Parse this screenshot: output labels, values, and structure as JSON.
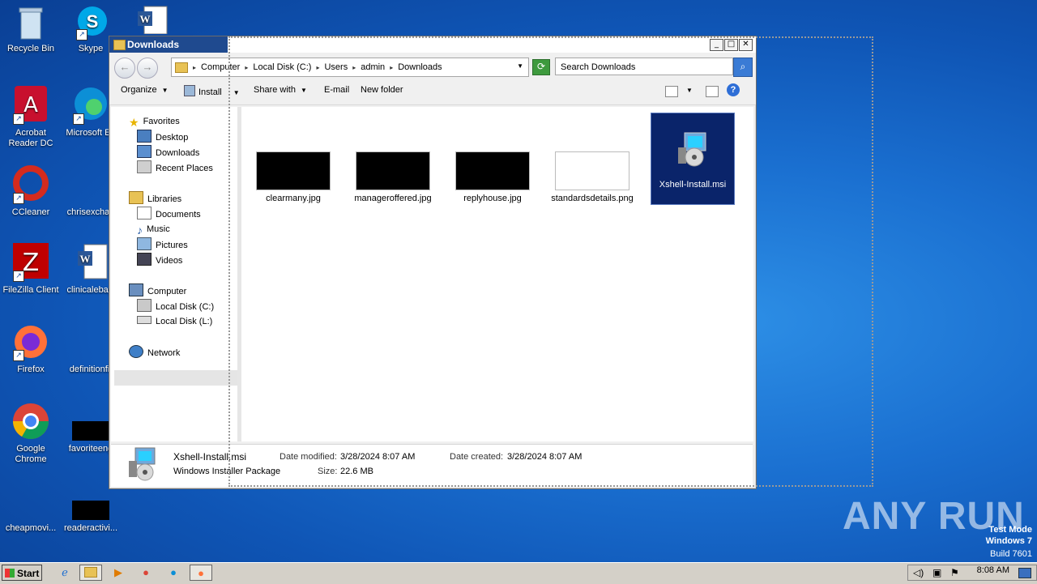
{
  "desktop": {
    "icons": [
      {
        "label": "Recycle Bin"
      },
      {
        "label": "Skype"
      },
      {
        "label": "Acrobat Reader DC"
      },
      {
        "label": "Microsoft Ed"
      },
      {
        "label": "CCleaner"
      },
      {
        "label": "chrisexchan"
      },
      {
        "label": "FileZilla Client"
      },
      {
        "label": "clinicalebay."
      },
      {
        "label": "Firefox"
      },
      {
        "label": "definitionfi."
      },
      {
        "label": "Google Chrome"
      },
      {
        "label": "favoriteeng"
      },
      {
        "label": "cheapmovi..."
      },
      {
        "label": "readeractivi..."
      }
    ]
  },
  "window": {
    "title": "Downloads",
    "controls": {
      "min": "_",
      "max": "□",
      "close": "✕"
    },
    "address": {
      "crumbs": [
        "Computer",
        "Local Disk (C:)",
        "Users",
        "admin",
        "Downloads"
      ]
    },
    "search": {
      "placeholder": "Search Downloads"
    },
    "toolbar": {
      "organize": "Organize",
      "install": "Install",
      "share_with": "Share with",
      "email": "E-mail",
      "new_folder": "New folder",
      "help": "?"
    },
    "nav": {
      "favorites": "Favorites",
      "desktop": "Desktop",
      "downloads": "Downloads",
      "recent": "Recent Places",
      "libraries": "Libraries",
      "documents": "Documents",
      "music": "Music",
      "pictures": "Pictures",
      "videos": "Videos",
      "computer": "Computer",
      "local_c": "Local Disk (C:)",
      "local_l": "Local Disk (L:)",
      "network": "Network"
    },
    "files": [
      {
        "name": "clearmany.jpg"
      },
      {
        "name": "manageroffered.jpg"
      },
      {
        "name": "replyhouse.jpg"
      },
      {
        "name": "standardsdetails.png"
      },
      {
        "name": "Xshell-Install.msi"
      }
    ],
    "details": {
      "name": "Xshell-Install.msi",
      "type": "Windows Installer Package",
      "modified_label": "Date modified:",
      "modified": "3/28/2024 8:07 AM",
      "created_label": "Date created:",
      "created": "3/28/2024 8:07 AM",
      "size_label": "Size:",
      "size": "22.6 MB"
    }
  },
  "taskbar": {
    "start": "Start",
    "clock": "8:08 AM"
  },
  "watermark": {
    "brand": "ANY RUN",
    "line1": "Test Mode",
    "line2": "Windows 7",
    "line3": "Build 7601"
  }
}
